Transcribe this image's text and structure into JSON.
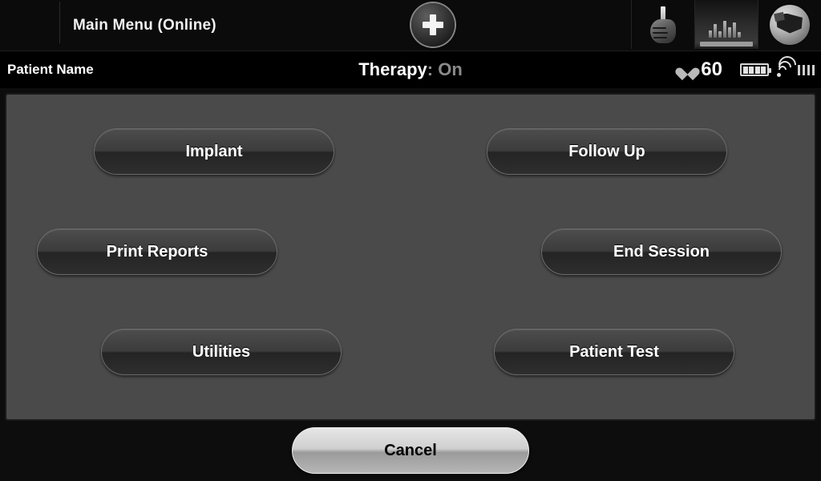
{
  "header": {
    "title": "Main Menu (Online)",
    "add_button_icon": "plus-icon",
    "icons": [
      {
        "name": "stylus-hand-icon",
        "active": false
      },
      {
        "name": "egm-waveform-icon",
        "active": true
      },
      {
        "name": "device-programmer-icon",
        "active": false
      }
    ]
  },
  "statusbar": {
    "patient_name": "Patient Name",
    "therapy_label": "Therapy",
    "therapy_separator": ":",
    "therapy_value": "On",
    "heart_rate": "60",
    "heart_icon": "heart-icon",
    "battery_icon": "battery-icon",
    "battery_cells": 4,
    "telemetry_icon": "wifi-telemetry-icon",
    "signal_bars": 4
  },
  "main": {
    "buttons": [
      {
        "id": "implant",
        "label": "Implant"
      },
      {
        "id": "follow-up",
        "label": "Follow Up"
      },
      {
        "id": "print-reports",
        "label": "Print Reports"
      },
      {
        "id": "end-session",
        "label": "End Session"
      },
      {
        "id": "utilities",
        "label": "Utilities"
      },
      {
        "id": "patient-test",
        "label": "Patient Test"
      }
    ]
  },
  "footer": {
    "cancel_label": "Cancel"
  },
  "colors": {
    "screen_background": "#0d0d0d",
    "panel_background": "#4a4a4a",
    "button_text": "#ffffff",
    "cancel_text": "#000000",
    "therapy_value": "#8a8a8a",
    "accent_white": "#ffffff"
  }
}
